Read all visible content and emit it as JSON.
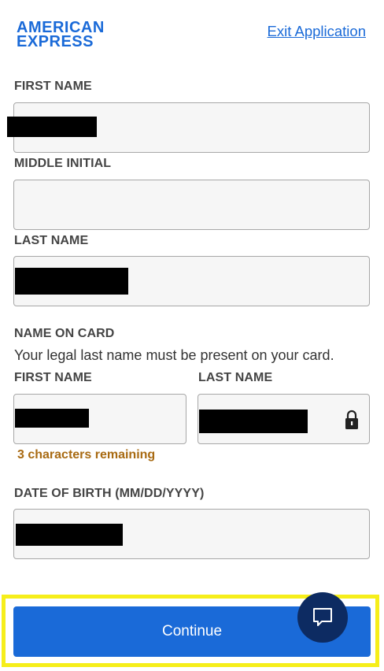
{
  "header": {
    "logo_line1": "AMERICAN",
    "logo_line2": "EXPRESS",
    "exit_label": "Exit Application"
  },
  "form": {
    "first_name_label": "FIRST NAME",
    "middle_initial_label": "MIDDLE INITIAL",
    "last_name_label": "LAST NAME",
    "name_on_card_label": "NAME ON CARD",
    "name_on_card_help": "Your legal last name must be present on your card.",
    "card_first_name_label": "FIRST NAME",
    "card_last_name_label": "LAST NAME",
    "characters_remaining": "3 characters remaining",
    "dob_label": "DATE OF BIRTH (MM/DD/YYYY)"
  },
  "actions": {
    "continue_label": "Continue"
  },
  "icons": {
    "lock": "lock-icon",
    "chat": "chat-icon"
  },
  "colors": {
    "brand_blue": "#1a6ad8",
    "chat_navy": "#0d2b62",
    "highlight": "#f6ee1a",
    "counter": "#a86a12"
  }
}
